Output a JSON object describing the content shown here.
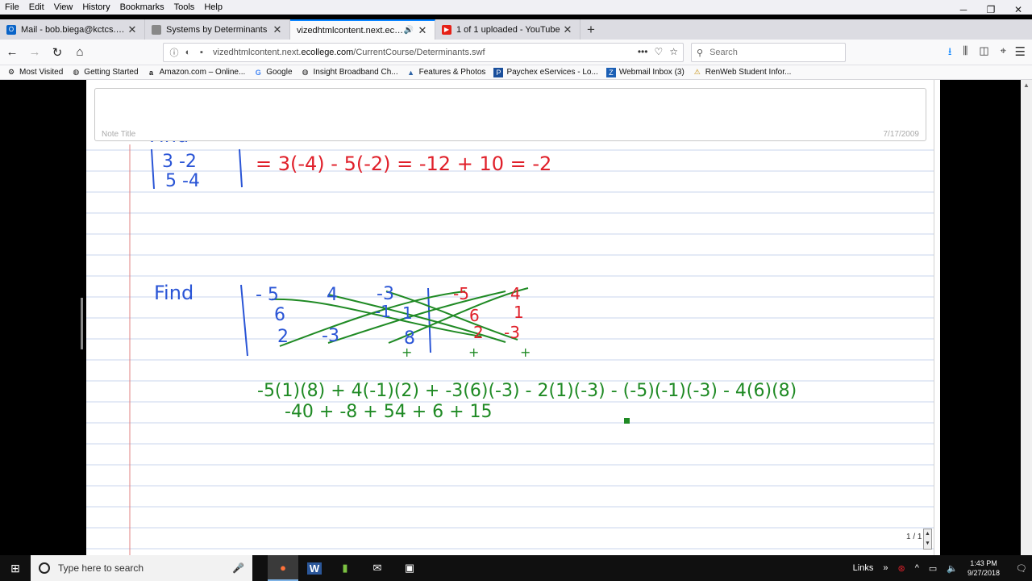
{
  "menubar": {
    "items": [
      "File",
      "Edit",
      "View",
      "History",
      "Bookmarks",
      "Tools",
      "Help"
    ]
  },
  "tabs": [
    {
      "title": "Mail - bob.biega@kctcs.edu",
      "favicon": "outlook-icon",
      "color": "#0a64c8",
      "glyph": "O"
    },
    {
      "title": "Systems by Determinants",
      "favicon": "page-icon",
      "color": "#888888",
      "glyph": ""
    },
    {
      "title": "vizedhtmlcontent.next.ecollege",
      "favicon": "",
      "color": "",
      "glyph": "",
      "active": true
    },
    {
      "title": "1 of 1 uploaded - YouTube",
      "favicon": "youtube-icon",
      "color": "#e62117",
      "glyph": "▶"
    }
  ],
  "navbar": {
    "url_prefix": "vizedhtmlcontent.next.",
    "url_domain": "ecollege.com",
    "url_path": "/CurrentCourse/Determinants.swf",
    "search_placeholder": "Search"
  },
  "bookmarks": [
    {
      "label": "Most Visited",
      "icon": "gear-icon",
      "glyph": "⚙"
    },
    {
      "label": "Getting Started",
      "icon": "globe-icon",
      "glyph": "◍"
    },
    {
      "label": "Amazon.com – Online...",
      "icon": "amazon-icon",
      "glyph": "a"
    },
    {
      "label": "Google",
      "icon": "google-icon",
      "glyph": "G"
    },
    {
      "label": "Insight Broadband  Ch...",
      "icon": "globe-icon",
      "glyph": "◍"
    },
    {
      "label": "Features & Photos",
      "icon": "photo-icon",
      "glyph": "▲"
    },
    {
      "label": "Paychex eServices - Lo...",
      "icon": "paychex-icon",
      "glyph": "P"
    },
    {
      "label": "Webmail  Inbox (3)",
      "icon": "webmail-icon",
      "glyph": "Z"
    },
    {
      "label": "RenWeb Student Infor...",
      "icon": "renweb-icon",
      "glyph": "⚠"
    }
  ],
  "note": {
    "title_label": "Note Title",
    "date": "7/17/2009",
    "page_indicator": "1 / 1"
  },
  "handwriting": {
    "find1": "Find",
    "find2": "Find",
    "m1_row1": "3   -2",
    "m1_row2": "5   -4",
    "eq1_expand": "= 3(-4) - 5(-2) = -12 + 10 = -2",
    "m2_col1": [
      "- 5",
      "6",
      "2"
    ],
    "m2_col2": [
      "4",
      "-1",
      "-3"
    ],
    "m2_col3": [
      "-3",
      "1",
      "8"
    ],
    "m2_ext1": [
      "-5",
      "6",
      "2"
    ],
    "m2_ext2": [
      "4",
      "1",
      "-3"
    ],
    "plus": "+",
    "expansion": "-5(1)(8) + 4(-1)(2) + -3(6)(-3) - 2(1)(-3) - (-5)(-1)(-3) - 4(6)(8)",
    "products": "-40  +  -8   +  54   + 6   + 15"
  },
  "colors": {
    "blue_ink": "#2a55d6",
    "red_ink": "#e0202a",
    "green_ink": "#1f8a24",
    "rule_line": "#c9d4ec",
    "margin_line": "#e08080"
  },
  "taskbar": {
    "search_placeholder": "Type here to search",
    "links_label": "Links",
    "time": "1:43 PM",
    "date": "9/27/2018"
  }
}
